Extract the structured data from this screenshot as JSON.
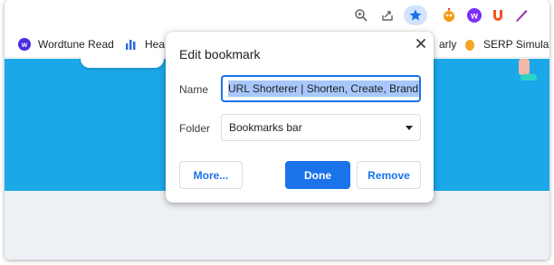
{
  "toolbar": {
    "icons": [
      "zoom-icon",
      "share-icon",
      "bookmark-star-icon",
      "extension-robot-icon",
      "wordtune-extension-icon",
      "ubersuggest-extension-icon",
      "pen-extension-icon"
    ]
  },
  "bookmarks_bar": {
    "items": [
      {
        "label": "Wordtune Read",
        "icon": "wordtune-icon"
      },
      {
        "label": "Hea",
        "icon": "bars-icon"
      },
      {
        "label": "arly",
        "icon": ""
      },
      {
        "label": "SERP Simulator",
        "icon": "serp-simulator-icon"
      }
    ]
  },
  "dialog": {
    "title": "Edit bookmark",
    "name_label": "Name",
    "name_value": "URL Shorterer | Shorten, Create, Brand, &",
    "folder_label": "Folder",
    "folder_value": "Bookmarks bar",
    "more_button": "More...",
    "done_button": "Done",
    "remove_button": "Remove"
  },
  "colors": {
    "accent": "#1a73e8",
    "hero": "#1ba8e9",
    "selection": "#a8c7fa"
  }
}
